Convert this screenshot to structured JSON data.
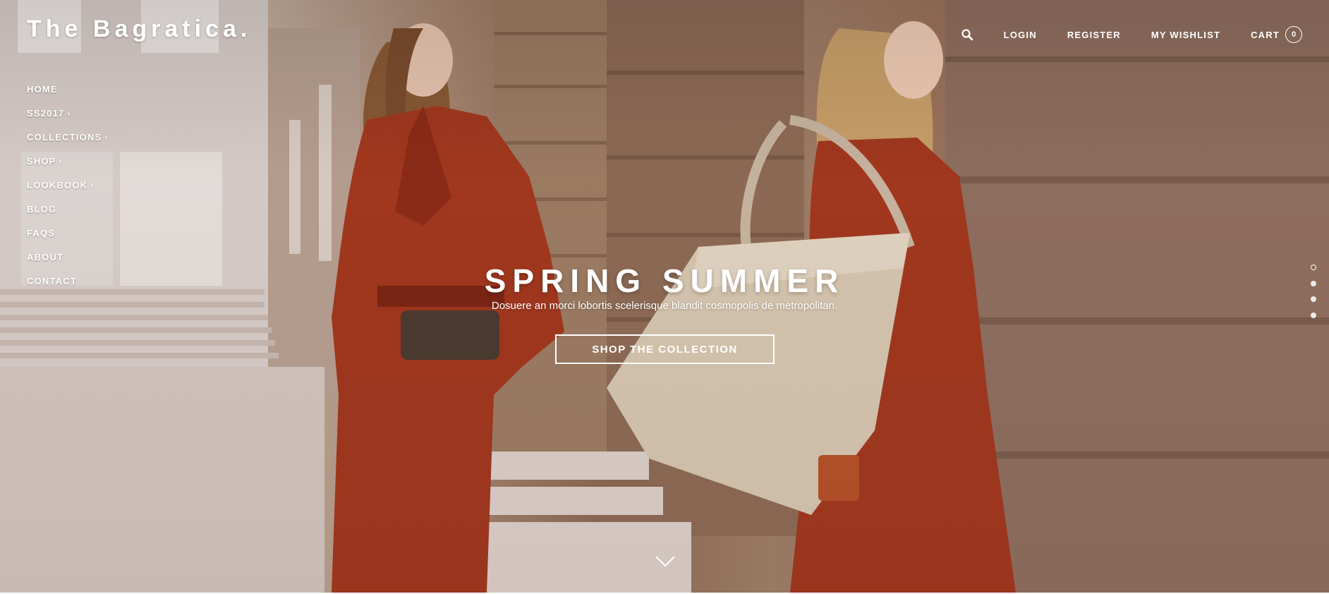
{
  "brand": {
    "logo": "The Bagratica."
  },
  "side_nav": [
    {
      "label": "HOME",
      "has_submenu": false
    },
    {
      "label": "SS2017",
      "has_submenu": true
    },
    {
      "label": "COLLECTIONS",
      "has_submenu": true
    },
    {
      "label": "SHOP",
      "has_submenu": true
    },
    {
      "label": "LOOKBOOK",
      "has_submenu": true
    },
    {
      "label": "BLOG",
      "has_submenu": false
    },
    {
      "label": "FAQS",
      "has_submenu": false
    },
    {
      "label": "ABOUT",
      "has_submenu": false
    },
    {
      "label": "CONTACT",
      "has_submenu": false
    }
  ],
  "top_nav": {
    "search_icon": "search-icon",
    "login": "LOGIN",
    "register": "REGISTER",
    "wishlist": "MY WISHLIST",
    "cart_label": "CART",
    "cart_count": "0"
  },
  "hero": {
    "title": "SPRING SUMMER",
    "subtitle": "Dosuere an morci lobortis scelerisque blandit cosmopolis de metropolitan.",
    "cta": "SHOP THE COLLECTION",
    "slides": {
      "count": 4,
      "active_index": 0
    },
    "scroll_icon": "chevron-down-icon"
  },
  "colors": {
    "text": "#ffffff",
    "dress_red": "#a3381f",
    "bag_beige": "#d7c6b0",
    "stone": "#9c7a62"
  }
}
